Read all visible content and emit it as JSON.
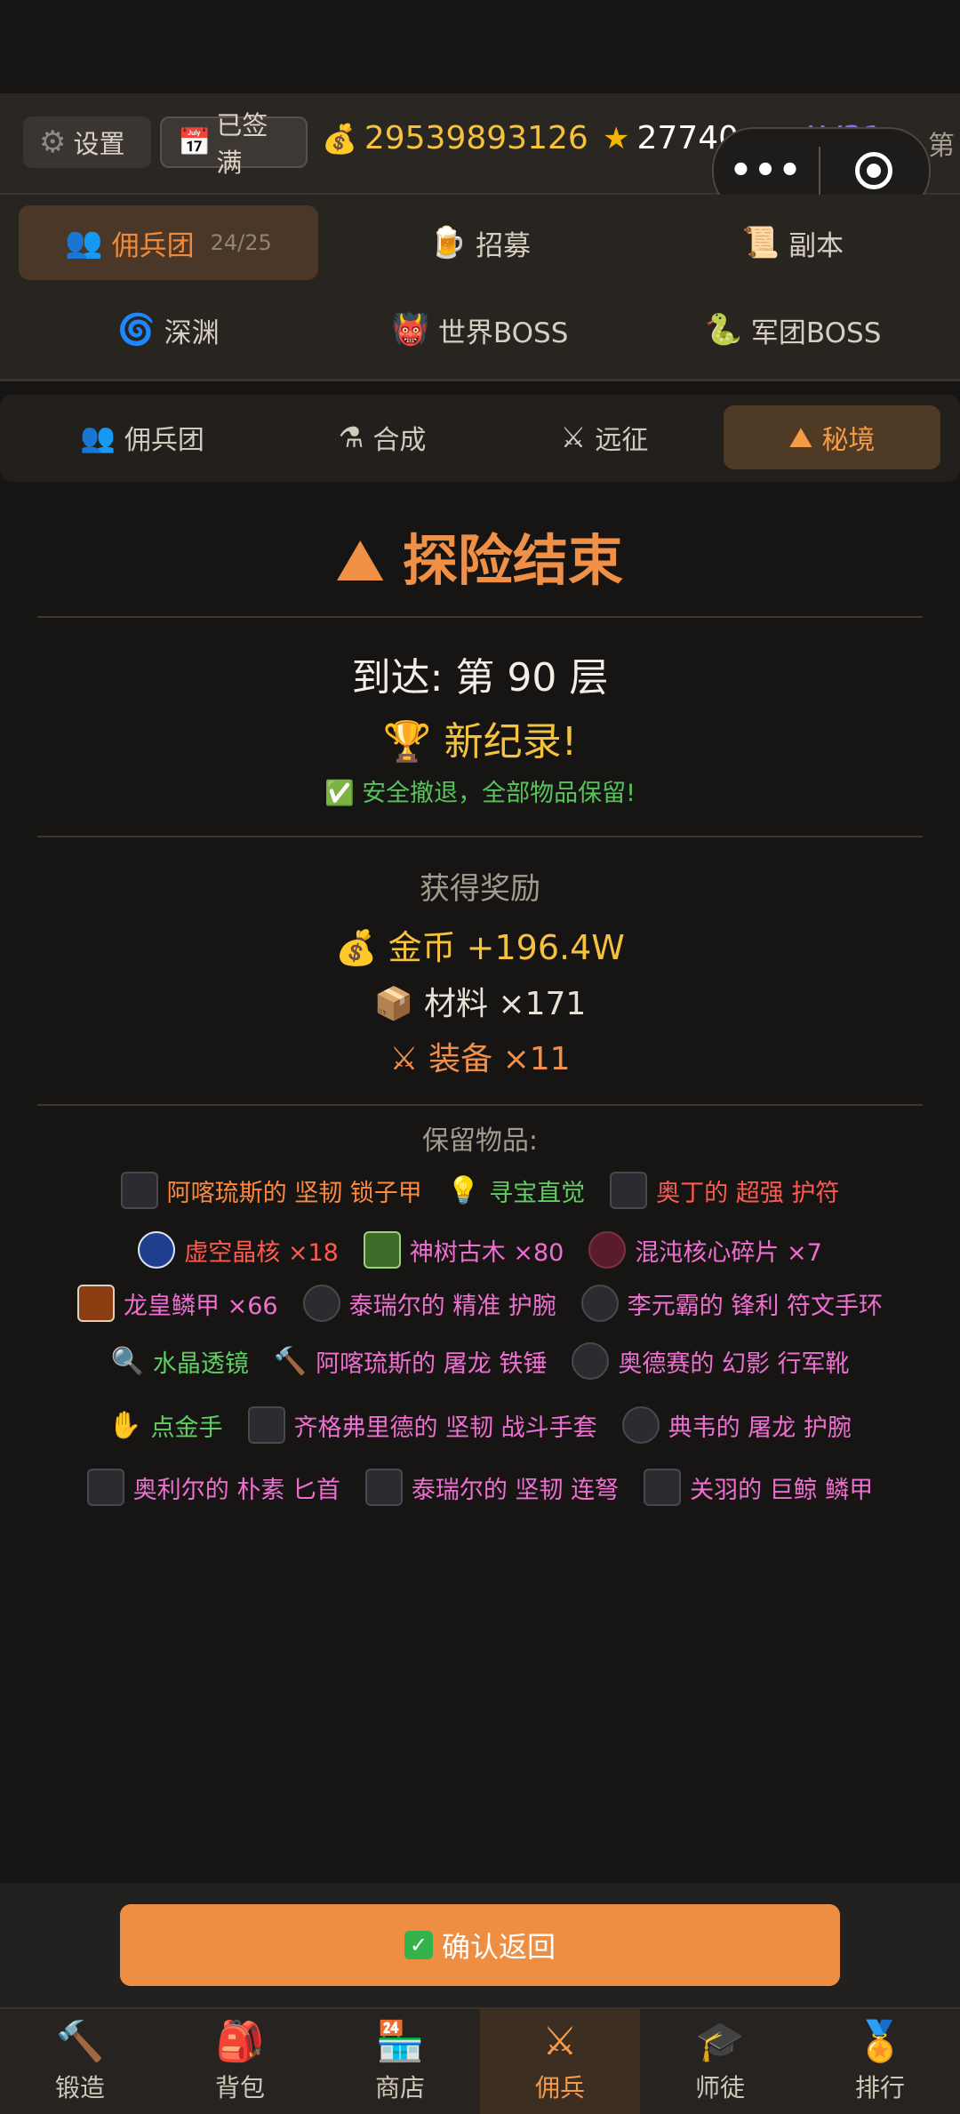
{
  "topbar": {
    "settings": "设置",
    "signed": "已签满",
    "gold": "29539893126",
    "stars": "27740",
    "level": "LV31",
    "truncated": "第"
  },
  "capsule": {
    "more": "•••"
  },
  "mainnav": {
    "items": [
      {
        "label": "佣兵团",
        "sub": "24/25",
        "icon": "mercenary-icon"
      },
      {
        "label": "招募",
        "icon": "beer-icon"
      },
      {
        "label": "副本",
        "icon": "scroll-icon"
      },
      {
        "label": "深渊",
        "icon": "vortex-icon"
      },
      {
        "label": "世界BOSS",
        "icon": "ogre-icon"
      },
      {
        "label": "军团BOSS",
        "icon": "serpent-icon"
      }
    ]
  },
  "subnav": {
    "items": [
      {
        "label": "佣兵团",
        "icon": "mercenary-icon"
      },
      {
        "label": "合成",
        "icon": "flask-icon"
      },
      {
        "label": "远征",
        "icon": "crossed-swords-icon"
      },
      {
        "label": "秘境",
        "icon": "mountain-icon"
      }
    ]
  },
  "result": {
    "title": "探险结束",
    "floor": "到达: 第 90 层",
    "record": "新纪录!",
    "safe": "安全撤退，全部物品保留!",
    "rewards_head": "获得奖励",
    "gold": "金币 +196.4W",
    "material": "材料 ×171",
    "equipment": "装备 ×11",
    "keep_head": "保留物品:"
  },
  "kept_items": {
    "row1": [
      "阿喀琉斯的 坚韧 锁子甲",
      "寻宝直觉",
      "奥丁的 超强 护符"
    ],
    "row2": [
      "虚空晶核 ×18",
      "神树古木 ×80",
      "混沌核心碎片 ×7"
    ],
    "row3": [
      "龙皇鳞甲 ×66",
      "泰瑞尔的 精准 护腕",
      "李元霸的 锋利 符文手环"
    ],
    "row4": [
      "水晶透镜",
      "阿喀琉斯的 屠龙 铁锤",
      "奥德赛的 幻影 行军靴"
    ],
    "row5": [
      "点金手",
      "齐格弗里德的 坚韧 战斗手套",
      "典韦的 屠龙 护腕"
    ],
    "row6": [
      "奥利尔的 朴素 匕首",
      "泰瑞尔的 坚韧 连弩",
      "关羽的 巨鲸 鳞甲"
    ]
  },
  "confirm": {
    "label": "确认返回"
  },
  "tabbar": {
    "items": [
      {
        "label": "锻造",
        "icon": "hammer-icon"
      },
      {
        "label": "背包",
        "icon": "backpack-icon"
      },
      {
        "label": "商店",
        "icon": "shop-icon"
      },
      {
        "label": "佣兵",
        "icon": "crossed-swords-icon"
      },
      {
        "label": "师徒",
        "icon": "graduation-cap-icon"
      },
      {
        "label": "排行",
        "icon": "medal-icon"
      }
    ]
  },
  "colors": {
    "accent": "#f08a3a",
    "gold": "#f5c23e",
    "success": "#58c35a",
    "confirm": "#ee8e42"
  }
}
